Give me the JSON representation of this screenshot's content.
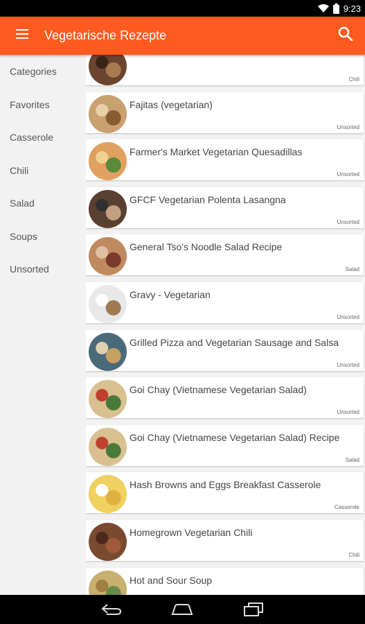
{
  "status": {
    "time": "9:23"
  },
  "app": {
    "title": "Vegetarische Rezepte",
    "accent": "#ff5a1f"
  },
  "sidebar": {
    "items": [
      {
        "label": "Categories"
      },
      {
        "label": "Favorites"
      },
      {
        "label": "Casserole"
      },
      {
        "label": "Chili"
      },
      {
        "label": "Salad"
      },
      {
        "label": "Soups"
      },
      {
        "label": "Unsorted"
      }
    ]
  },
  "recipes": [
    {
      "title": "",
      "category": "Chili",
      "thumb": [
        "#6b4430",
        "#a87a50",
        "#3a2418"
      ]
    },
    {
      "title": "Fajitas (vegetarian)",
      "category": "Unsorted",
      "thumb": [
        "#c9a070",
        "#8a5a30",
        "#e8d0a8"
      ]
    },
    {
      "title": "Farmer's Market Vegetarian Quesadillas",
      "category": "Unsorted",
      "thumb": [
        "#e0a060",
        "#5a8a3a",
        "#f0d090"
      ]
    },
    {
      "title": "GFCF Vegetarian Polenta Lasangna",
      "category": "Unsorted",
      "thumb": [
        "#5a4030",
        "#c0a080",
        "#303030"
      ]
    },
    {
      "title": "General Tso's Noodle Salad Recipe",
      "category": "Salad",
      "thumb": [
        "#c08a60",
        "#7a3a2a",
        "#e0c0a0"
      ]
    },
    {
      "title": "Gravy - Vegetarian",
      "category": "Unsorted",
      "thumb": [
        "#e8e8e8",
        "#a07a50",
        "#ffffff"
      ]
    },
    {
      "title": "Grilled Pizza and Vegetarian Sausage and Salsa",
      "category": "Unsorted",
      "thumb": [
        "#4a6a7a",
        "#c8a060",
        "#e0d0b0"
      ]
    },
    {
      "title": "Goi Chay (Vietnamese Vegetarian Salad)",
      "category": "Unsorted",
      "thumb": [
        "#d8c090",
        "#4a7a3a",
        "#c04030"
      ]
    },
    {
      "title": "Goi Chay (Vietnamese Vegetarian Salad) Recipe",
      "category": "Salad",
      "thumb": [
        "#d8c090",
        "#4a7a3a",
        "#c04030"
      ]
    },
    {
      "title": "Hash Browns and Eggs Breakfast Casserole",
      "category": "Casserole",
      "thumb": [
        "#f0d060",
        "#e0b040",
        "#ffffff"
      ]
    },
    {
      "title": "Homegrown Vegetarian Chili",
      "category": "Chili",
      "thumb": [
        "#7a4a30",
        "#a05a3a",
        "#4a2a1a"
      ]
    },
    {
      "title": "Hot and Sour Soup",
      "category": "",
      "thumb": [
        "#c8b070",
        "#6a8a4a",
        "#a08040"
      ]
    }
  ]
}
